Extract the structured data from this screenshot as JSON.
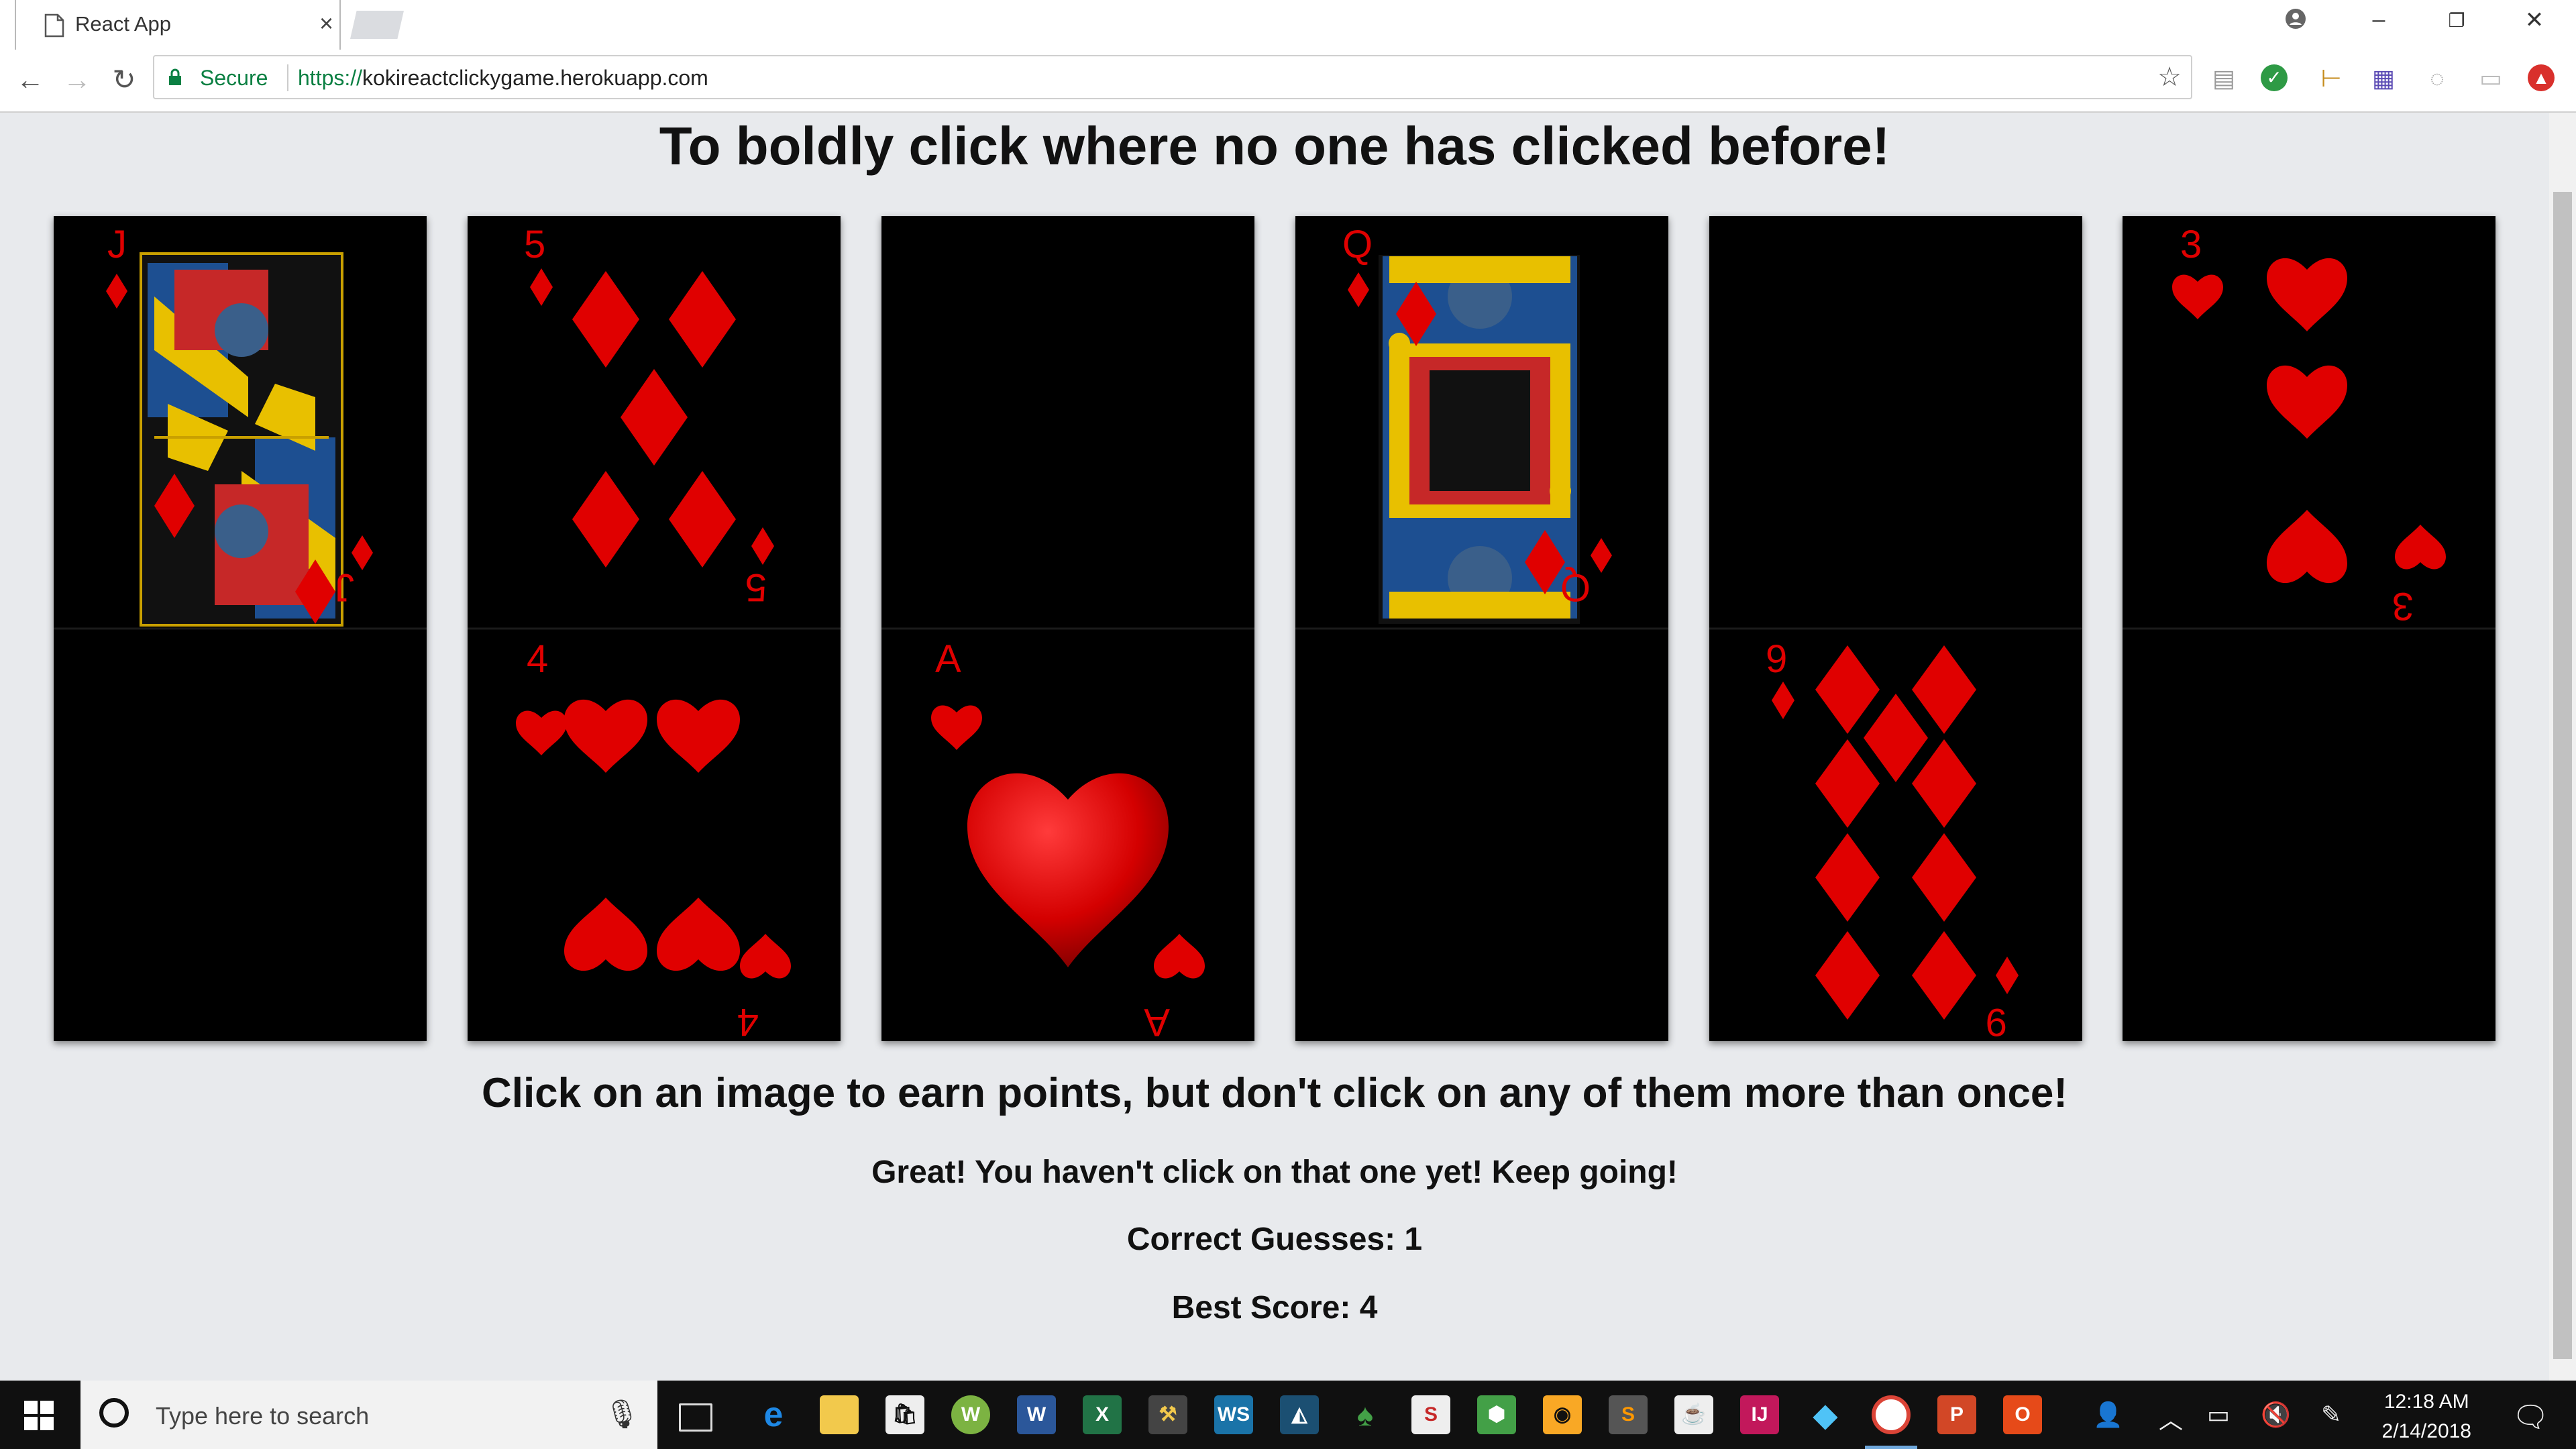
{
  "browser": {
    "tab_title": "React App",
    "tab_close": "×",
    "secure_label": "Secure",
    "url_scheme": "https://",
    "url_host": "kokireactclickygame.herokuapp.com",
    "window_controls": [
      "–",
      "❐",
      "✕"
    ]
  },
  "page": {
    "heading": "To boldly click where no one has clicked before!",
    "instructions": "Click on an image to earn points, but don't click on any of them more than once!",
    "message": "Great! You haven't click on that one yet! Keep going!",
    "correct_guesses": "Correct Guesses: 1",
    "best_score": "Best Score: 4"
  },
  "cards": [
    {
      "top": {
        "rank": "J",
        "suit": "diamond",
        "face": true
      },
      "bottom": {
        "rank": "",
        "suit": ""
      }
    },
    {
      "top": {
        "rank": "5",
        "suit": "diamond"
      },
      "bottom": {
        "rank": "4",
        "suit": "heart"
      }
    },
    {
      "top": {
        "rank": "",
        "suit": ""
      },
      "bottom": {
        "rank": "A",
        "suit": "heart"
      }
    },
    {
      "top": {
        "rank": "Q",
        "suit": "diamond",
        "face": true
      },
      "bottom": {
        "rank": "",
        "suit": ""
      }
    },
    {
      "top": {
        "rank": "",
        "suit": ""
      },
      "bottom": {
        "rank": "9",
        "suit": "diamond"
      }
    },
    {
      "top": {
        "rank": "3",
        "suit": "heart"
      },
      "bottom": {
        "rank": "",
        "suit": ""
      }
    }
  ],
  "colors": {
    "card_bg": "#000000",
    "suit_red": "#e00000",
    "page_bg": "#e8eaed",
    "secure_green": "#0b8043"
  },
  "taskbar": {
    "search_placeholder": "Type here to search",
    "time": "12:18 AM",
    "date": "2/14/2018",
    "apps": [
      "task-view",
      "edge",
      "file-explorer",
      "store",
      "app-w",
      "word",
      "excel",
      "app-tool",
      "webstorm",
      "mysql-workbench",
      "app-green",
      "sublime-s",
      "node",
      "app-yellow",
      "sublime-text",
      "java",
      "intellij",
      "sourcetree",
      "chrome",
      "powerpoint",
      "office"
    ]
  }
}
